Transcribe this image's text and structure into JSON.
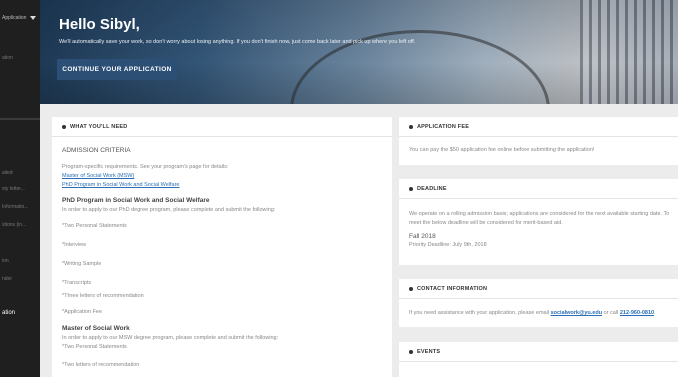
{
  "sidebar": {
    "top_label": "Application",
    "items": [
      {
        "label": "ation"
      },
      {
        "label": "ailed"
      },
      {
        "label": "sty letter..."
      },
      {
        "label": "Informatio..."
      },
      {
        "label": "stions (in..."
      },
      {
        "label": "ion"
      },
      {
        "label": "nder"
      }
    ],
    "active_label": "ation"
  },
  "hero": {
    "title": "Hello Sibyl,",
    "subtitle": "We'll automatically save your work, so don't worry about losing anything. If you don't finish now, just come back later and pick up where you left off.",
    "button_label": "CONTINUE YOUR APPLICATION"
  },
  "need": {
    "title": "WHAT YOU'LL NEED",
    "admission_heading": "ADMISSION CRITERIA",
    "intro": "Program-specific requirements. See your program's page for details:",
    "link_msw": "Master of Social Work (MSW)",
    "link_phd": "PhD Program in Social Work and Social Welfare",
    "phd_heading": "PhD Program in Social Work and Social Welfare",
    "phd_intro": "In order to apply to our PhD degree program, please complete and submit the following:",
    "phd_items": [
      "*Two Personal Statements",
      "*Interview",
      "*Writing Sample",
      "*Transcripts",
      "*Three letters of recommendation",
      "*Application Fee"
    ],
    "msw_heading": "Master of Social Work",
    "msw_intro": "In order to apply to our MSW degree program, please complete and submit the following:",
    "msw_items": [
      "*Two Personal Statements",
      "*Two letters of recommendation"
    ]
  },
  "fee": {
    "title": "APPLICATION FEE",
    "text": "You can pay the $50 application fee online before submitting the application!"
  },
  "deadline": {
    "title": "DEADLINE",
    "text1": "We operate on a rolling admission basis; applications are considered for the next available starting date. To",
    "text2": "meet the below deadline will be considered for merit-based aid.",
    "term": "Fall 2018",
    "priority": "Priority Deadline: July 9th, 2018"
  },
  "contact": {
    "title": "CONTACT INFORMATION",
    "text_before": "If you need assistance with your application, please email ",
    "email": "socialwork@yu.edu",
    "text_mid": " or call ",
    "phone": "212-960-0810",
    "text_after": "."
  },
  "events": {
    "title": "EVENTS"
  }
}
